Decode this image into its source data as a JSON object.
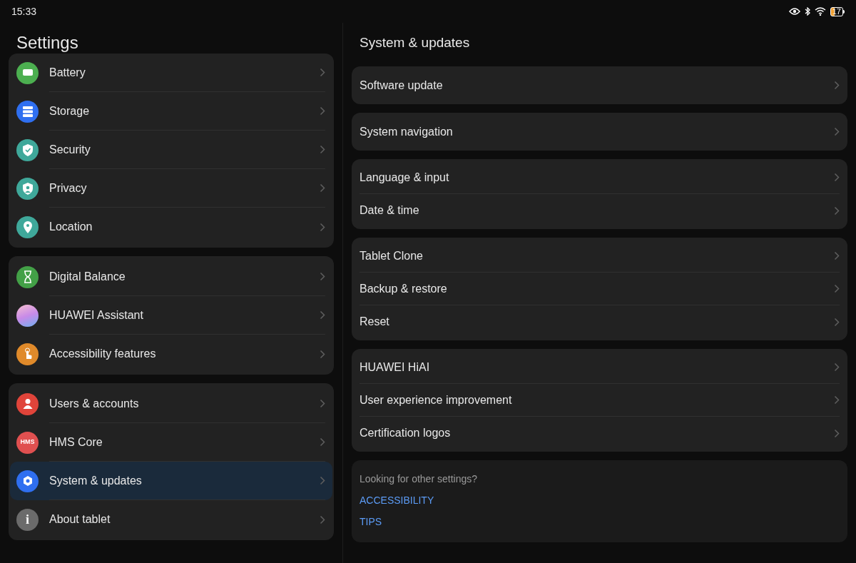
{
  "status_bar": {
    "time": "15:33",
    "battery": "17"
  },
  "sidebar": {
    "title": "Settings",
    "groups": [
      {
        "items": [
          {
            "label": "Battery",
            "color": "#4caf50",
            "selected": false
          },
          {
            "label": "Storage",
            "color": "#2f6ff0",
            "selected": false
          },
          {
            "label": "Security",
            "color": "#3fa89a",
            "selected": false
          },
          {
            "label": "Privacy",
            "color": "#3fa89a",
            "selected": false
          },
          {
            "label": "Location",
            "color": "#3fa89a",
            "selected": false
          }
        ]
      },
      {
        "items": [
          {
            "label": "Digital Balance",
            "color": "#43a047",
            "selected": false
          },
          {
            "label": "HUAWEI Assistant",
            "color": "#c88ae8",
            "selected": false
          },
          {
            "label": "Accessibility features",
            "color": "#e08a2a",
            "selected": false
          }
        ]
      },
      {
        "items": [
          {
            "label": "Users & accounts",
            "color": "#e0443a",
            "selected": false
          },
          {
            "label": "HMS Core",
            "color": "#e05050",
            "badge": "HMS",
            "selected": false
          },
          {
            "label": "System & updates",
            "color": "#2f6ff0",
            "selected": true
          },
          {
            "label": "About tablet",
            "color": "#6b6b6b",
            "badge": "i",
            "selected": false
          }
        ]
      }
    ]
  },
  "detail": {
    "title": "System & updates",
    "groups": [
      {
        "items": [
          "Software update"
        ]
      },
      {
        "items": [
          "System navigation"
        ]
      },
      {
        "items": [
          "Language & input",
          "Date & time"
        ]
      },
      {
        "items": [
          "Tablet Clone",
          "Backup & restore",
          "Reset"
        ]
      },
      {
        "items": [
          "HUAWEI HiAI",
          "User experience improvement",
          "Certification logos"
        ]
      }
    ],
    "footer": {
      "prompt": "Looking for other settings?",
      "links": [
        "ACCESSIBILITY",
        "TIPS"
      ]
    }
  }
}
